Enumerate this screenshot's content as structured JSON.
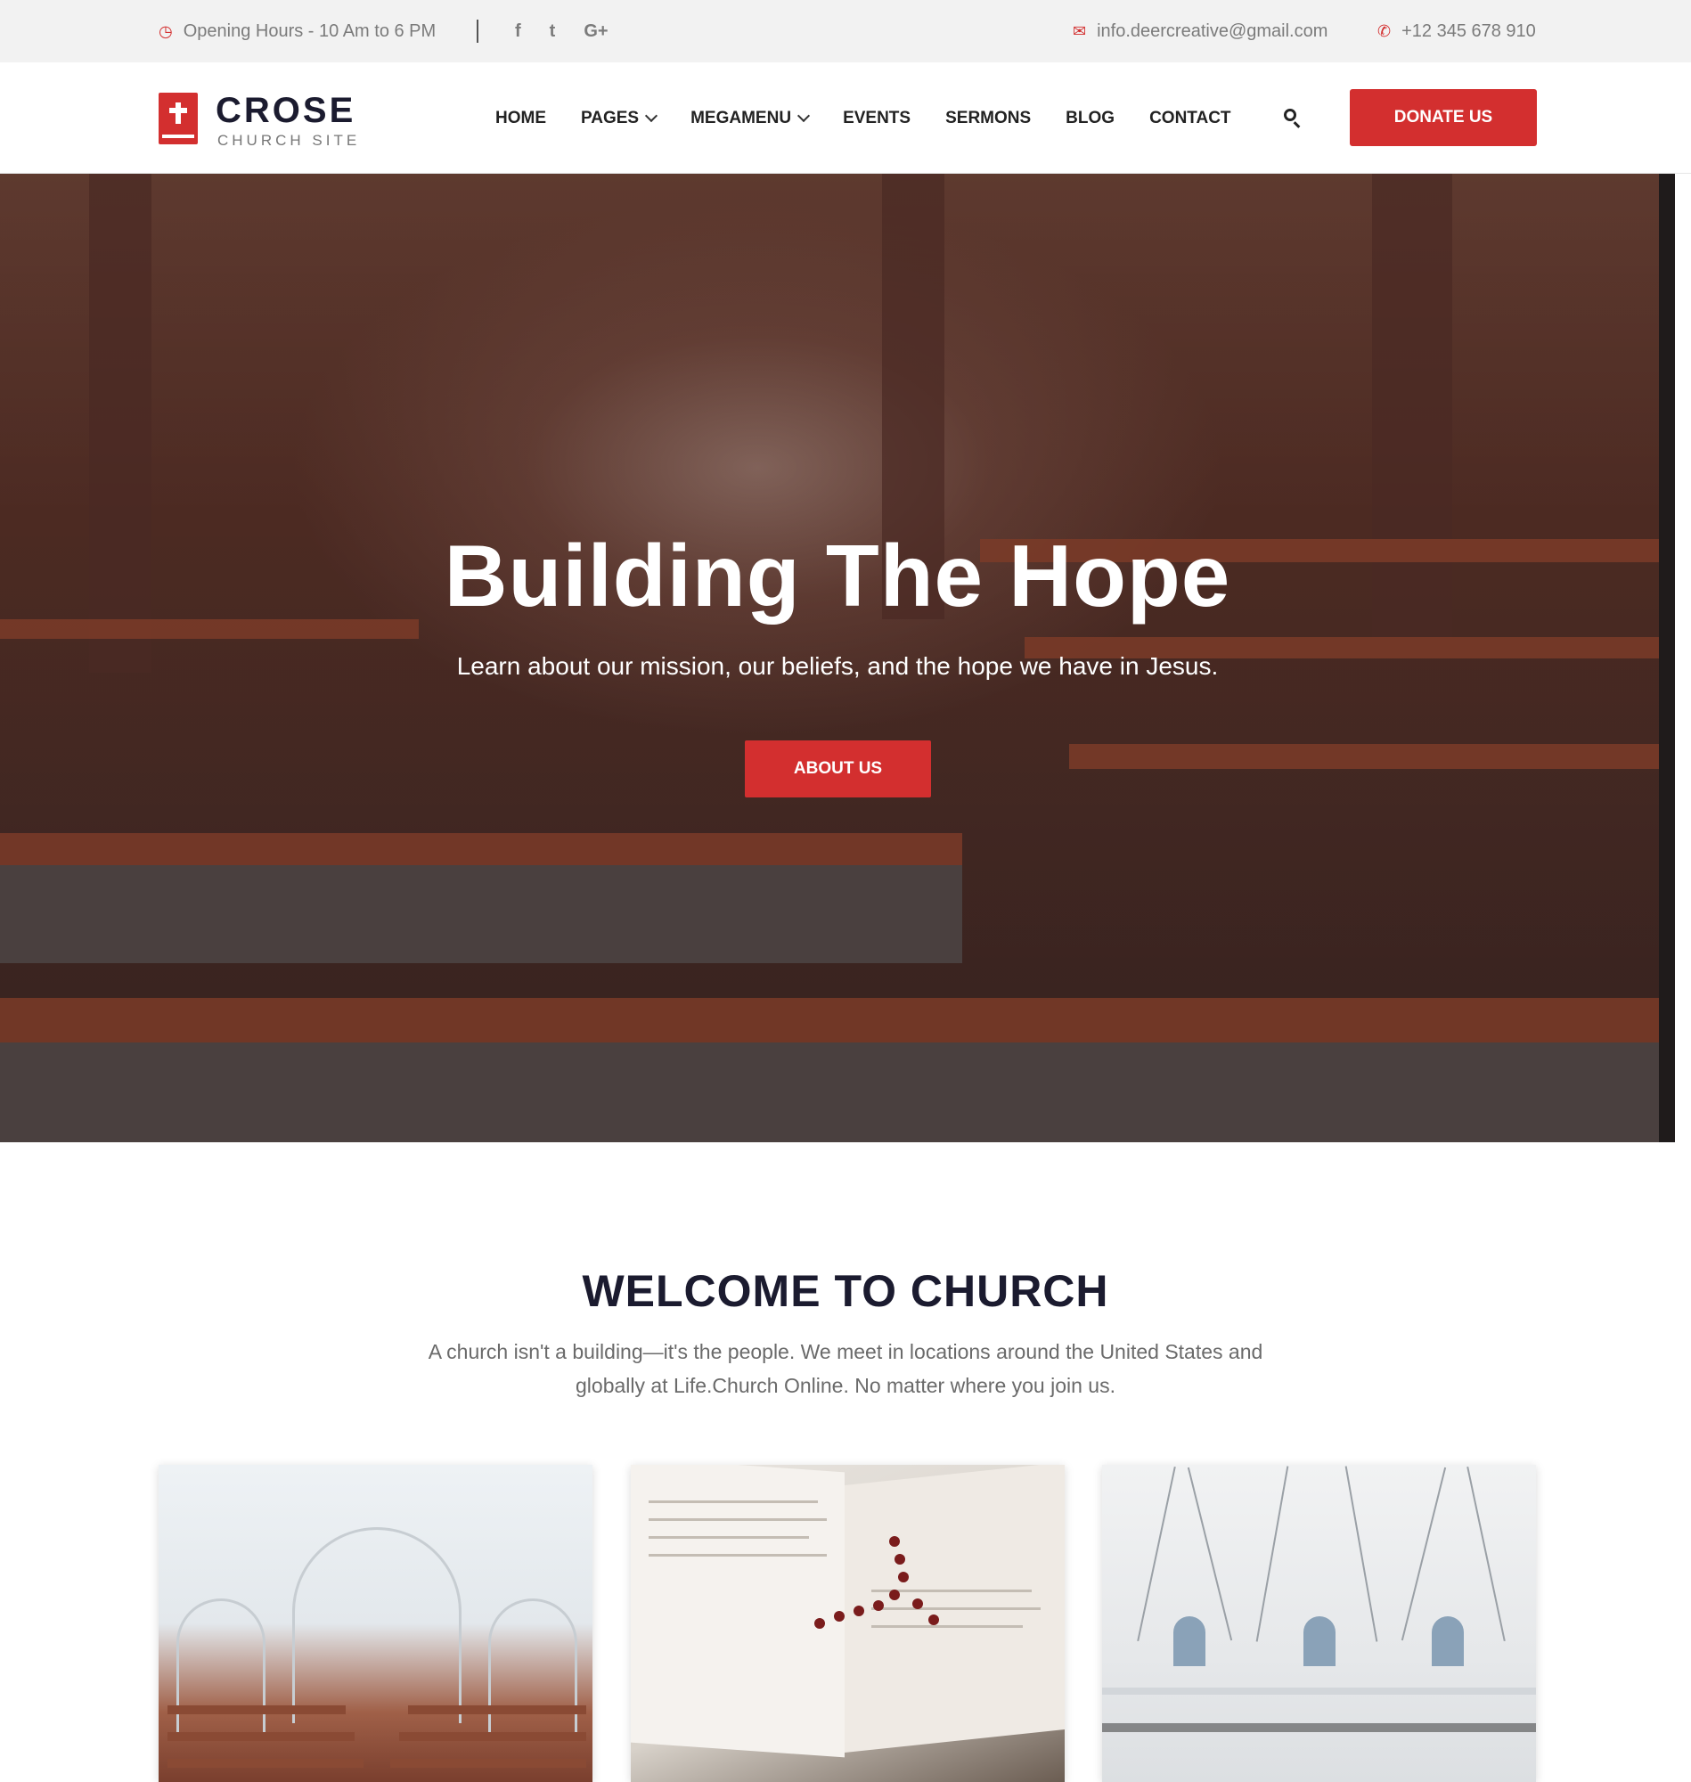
{
  "topbar": {
    "hours": "Opening Hours - 10 Am to 6 PM",
    "social": [
      "f",
      "t",
      "G+"
    ],
    "email": "info.deercreative@gmail.com",
    "phone": "+12 345 678 910"
  },
  "header": {
    "logo_name": "CROSE",
    "logo_sub": "CHURCH SITE",
    "nav": [
      {
        "label": "HOME",
        "dropdown": false
      },
      {
        "label": "PAGES",
        "dropdown": true
      },
      {
        "label": "MEGAMENU",
        "dropdown": true
      },
      {
        "label": "EVENTS",
        "dropdown": false
      },
      {
        "label": "SERMONS",
        "dropdown": false
      },
      {
        "label": "BLOG",
        "dropdown": false
      },
      {
        "label": "CONTACT",
        "dropdown": false
      }
    ],
    "donate_label": "DONATE US"
  },
  "hero": {
    "title": "Building The Hope",
    "subtitle": "Learn about our mission, our beliefs, and the hope we have in Jesus.",
    "button_label": "ABOUT US"
  },
  "welcome": {
    "title": "WELCOME TO CHURCH",
    "text": "A church isn't a building—it's the people. We meet in locations around the United States and globally at Life.Church Online. No matter where you join us."
  },
  "colors": {
    "accent": "#d32f2f",
    "dark_text": "#1b1b2f",
    "topbar_bg": "#f2f2f2"
  },
  "icons": {
    "hours": "clock-icon",
    "email": "envelope-icon",
    "phone": "phone-icon",
    "search": "search-icon"
  }
}
